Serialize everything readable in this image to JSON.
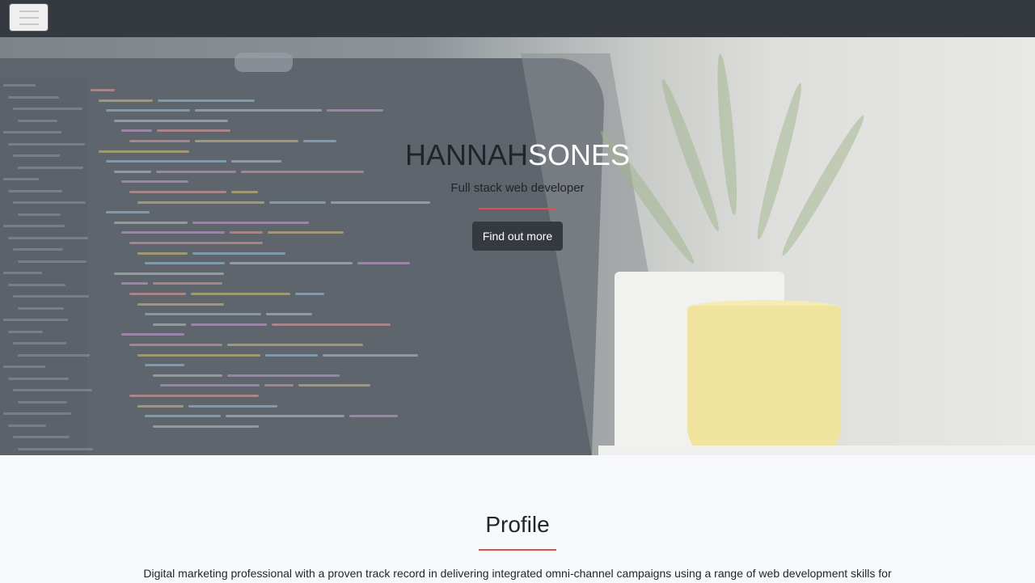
{
  "navbar": {
    "toggle_label": "Toggle navigation"
  },
  "hero": {
    "title_first": "HANNAH",
    "title_last": "SONES",
    "subtitle": "Full stack web developer",
    "cta_label": "Find out more"
  },
  "profile": {
    "heading": "Profile",
    "text": "Digital marketing professional with a proven track record in delivering integrated omni-channel campaigns using a range of web development skills for"
  },
  "colors": {
    "navbar_bg": "#343a40",
    "accent_red": "#e24d4d",
    "button_bg": "#343a40"
  }
}
